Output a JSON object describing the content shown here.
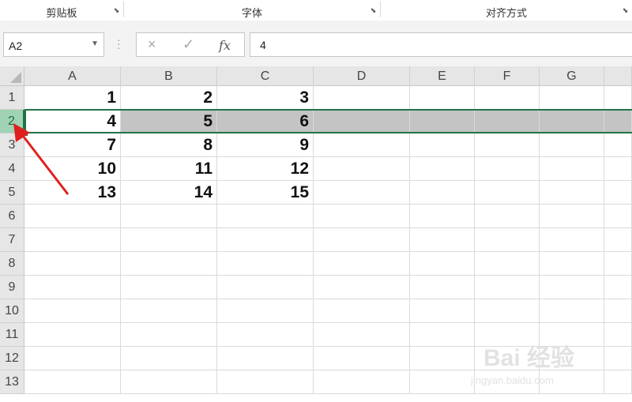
{
  "ribbon": {
    "groups": [
      {
        "label": "剪贴板"
      },
      {
        "label": "字体"
      },
      {
        "label": "对齐方式"
      }
    ]
  },
  "formula_bar": {
    "name_box": "A2",
    "cancel_icon": "×",
    "enter_icon": "✓",
    "fx_label": "fx",
    "value": "4"
  },
  "sheet": {
    "columns": [
      "A",
      "B",
      "C",
      "D",
      "E",
      "F",
      "G"
    ],
    "rows": [
      "1",
      "2",
      "3",
      "4",
      "5",
      "6",
      "7",
      "8",
      "9",
      "10",
      "11",
      "12",
      "13"
    ],
    "selected_row": "2",
    "active_cell": "A2",
    "data": [
      [
        "1",
        "2",
        "3"
      ],
      [
        "4",
        "5",
        "6"
      ],
      [
        "7",
        "8",
        "9"
      ],
      [
        "10",
        "11",
        "12"
      ],
      [
        "13",
        "14",
        "15"
      ]
    ]
  },
  "watermark": {
    "main": "Bai 经验",
    "sub": "jingyan.baidu.com"
  },
  "colors": {
    "selection_border": "#217346",
    "row_highlight": "#c4c4c4",
    "annotation_arrow": "#e02020"
  }
}
